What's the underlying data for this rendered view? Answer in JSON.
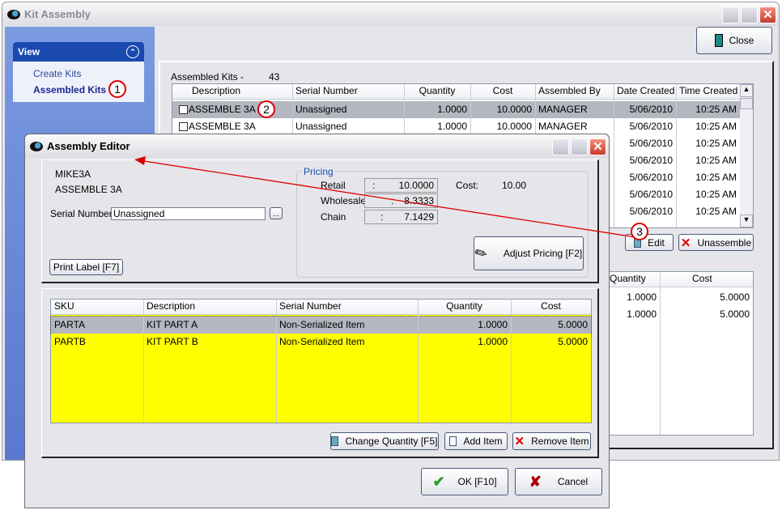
{
  "main_window": {
    "title": "Kit Assembly",
    "close_label": "Close"
  },
  "sidebar": {
    "header": "View",
    "items": [
      {
        "label": "Create Kits"
      },
      {
        "label": "Assembled Kits"
      }
    ]
  },
  "assembled": {
    "label": "Assembled Kits -",
    "count": "43",
    "columns": [
      "Description",
      "Serial Number",
      "Quantity",
      "Cost",
      "Assembled By",
      "Date Created",
      "Time Created"
    ],
    "rows": [
      [
        "ASSEMBLE 3A",
        "Unassigned",
        "1.0000",
        "10.0000",
        "MANAGER",
        "5/06/2010",
        "10:25 AM"
      ],
      [
        "ASSEMBLE 3A",
        "Unassigned",
        "1.0000",
        "10.0000",
        "MANAGER",
        "5/06/2010",
        "10:25 AM"
      ],
      [
        "",
        "",
        "",
        "",
        "",
        "5/06/2010",
        "10:25 AM"
      ],
      [
        "",
        "",
        "",
        "",
        "",
        "5/06/2010",
        "10:25 AM"
      ],
      [
        "",
        "",
        "",
        "",
        "",
        "5/06/2010",
        "10:25 AM"
      ],
      [
        "",
        "",
        "",
        "",
        "",
        "5/06/2010",
        "10:25 AM"
      ],
      [
        "",
        "",
        "",
        "",
        "",
        "5/06/2010",
        "10:25 AM"
      ]
    ],
    "edit_label": "Edit",
    "unassemble_label": "Unassemble"
  },
  "components": {
    "columns": [
      "Quantity",
      "Cost"
    ],
    "rows": [
      [
        "1.0000",
        "5.0000"
      ],
      [
        "1.0000",
        "5.0000"
      ]
    ]
  },
  "editor": {
    "title": "Assembly Editor",
    "sku": "MIKE3A",
    "description": "ASSEMBLE 3A",
    "serial_label": "Serial Number:",
    "serial_value": "Unassigned",
    "browse_label": "...",
    "print_label": "Print Label [F7]",
    "pricing": {
      "title": "Pricing",
      "retail_label": "Retail",
      "retail": "10.0000",
      "wholesale_label": "Wholesale",
      "wholesale": "8.3333",
      "chain_label": "Chain",
      "chain": "7.1429",
      "cost_label": "Cost:",
      "cost": "10.00",
      "sep": ":"
    },
    "adjust_label": "Adjust Pricing [F2]",
    "grid": {
      "columns": [
        "SKU",
        "Description",
        "Serial Number",
        "Quantity",
        "Cost"
      ],
      "rows": [
        [
          "PARTA",
          "KIT PART A",
          "Non-Serialized Item",
          "1.0000",
          "5.0000"
        ],
        [
          "PARTB",
          "KIT PART B",
          "Non-Serialized Item",
          "1.0000",
          "5.0000"
        ]
      ]
    },
    "change_qty_label": "Change Quantity [F5]",
    "add_item_label": "Add Item",
    "remove_item_label": "Remove Item",
    "ok_label": "OK [F10]",
    "cancel_label": "Cancel"
  },
  "annotations": [
    "1",
    "2",
    "3"
  ],
  "colors": {
    "sidebar": "#7a9ae0",
    "sidebar_header": "#1a4ab0",
    "highlight_row": "#b4b6c0",
    "yellow": "#ffff00",
    "annotation": "#dd0000"
  }
}
